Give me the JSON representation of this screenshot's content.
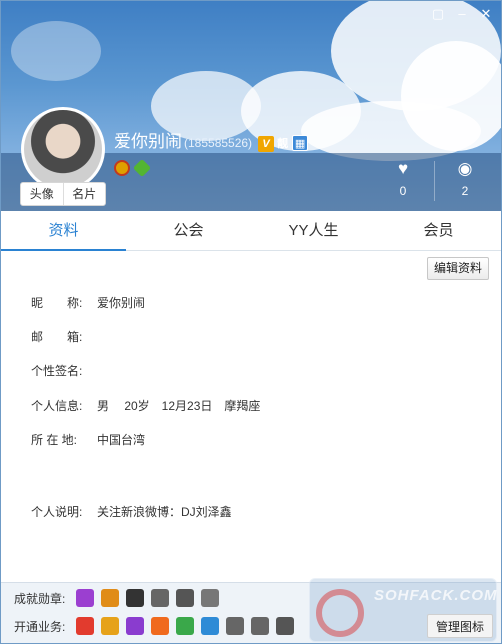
{
  "window": {
    "theme_icon": "shirt-icon",
    "minimize_icon": "minimize-icon",
    "close_icon": "close-icon"
  },
  "profile": {
    "nickname": "爱你别闹",
    "uid": "(185585526)",
    "v_badge": "V",
    "pretty_badge": "靓",
    "avatar_tabs": [
      "头像",
      "名片"
    ],
    "stats": [
      {
        "icon": "heart-icon",
        "value": "0"
      },
      {
        "icon": "ribbon-icon",
        "value": "2"
      }
    ]
  },
  "tabs": [
    "资料",
    "公会",
    "YY人生",
    "会员"
  ],
  "active_tab": "资料",
  "edit_button": "编辑资料",
  "fields": [
    {
      "label": "昵　　称:",
      "value": "爱你别闹"
    },
    {
      "label": "邮　　箱:",
      "value": ""
    },
    {
      "label": "个性签名:",
      "value": ""
    },
    {
      "label": "个人信息:",
      "value": "男　 20岁　12月23日　摩羯座"
    },
    {
      "label": "所 在 地:",
      "value": "中国台湾"
    },
    {
      "label": "个人说明:",
      "value": "关注新浪微博：DJ刘泽鑫"
    }
  ],
  "achievements": {
    "label": "成就勋章:",
    "colors": [
      "#9b3fd0",
      "#e08c18",
      "#333333",
      "#666666",
      "#555555",
      "#777777"
    ]
  },
  "services": {
    "label": "开通业务:",
    "colors": [
      "#e23b2e",
      "#e6a21a",
      "#8a3ccf",
      "#f06a1e",
      "#3aa84a",
      "#2e8bd6",
      "#666666",
      "#666666",
      "#555555"
    ]
  },
  "manage_button": "管理图标",
  "watermark": "SOHFACK.COM"
}
